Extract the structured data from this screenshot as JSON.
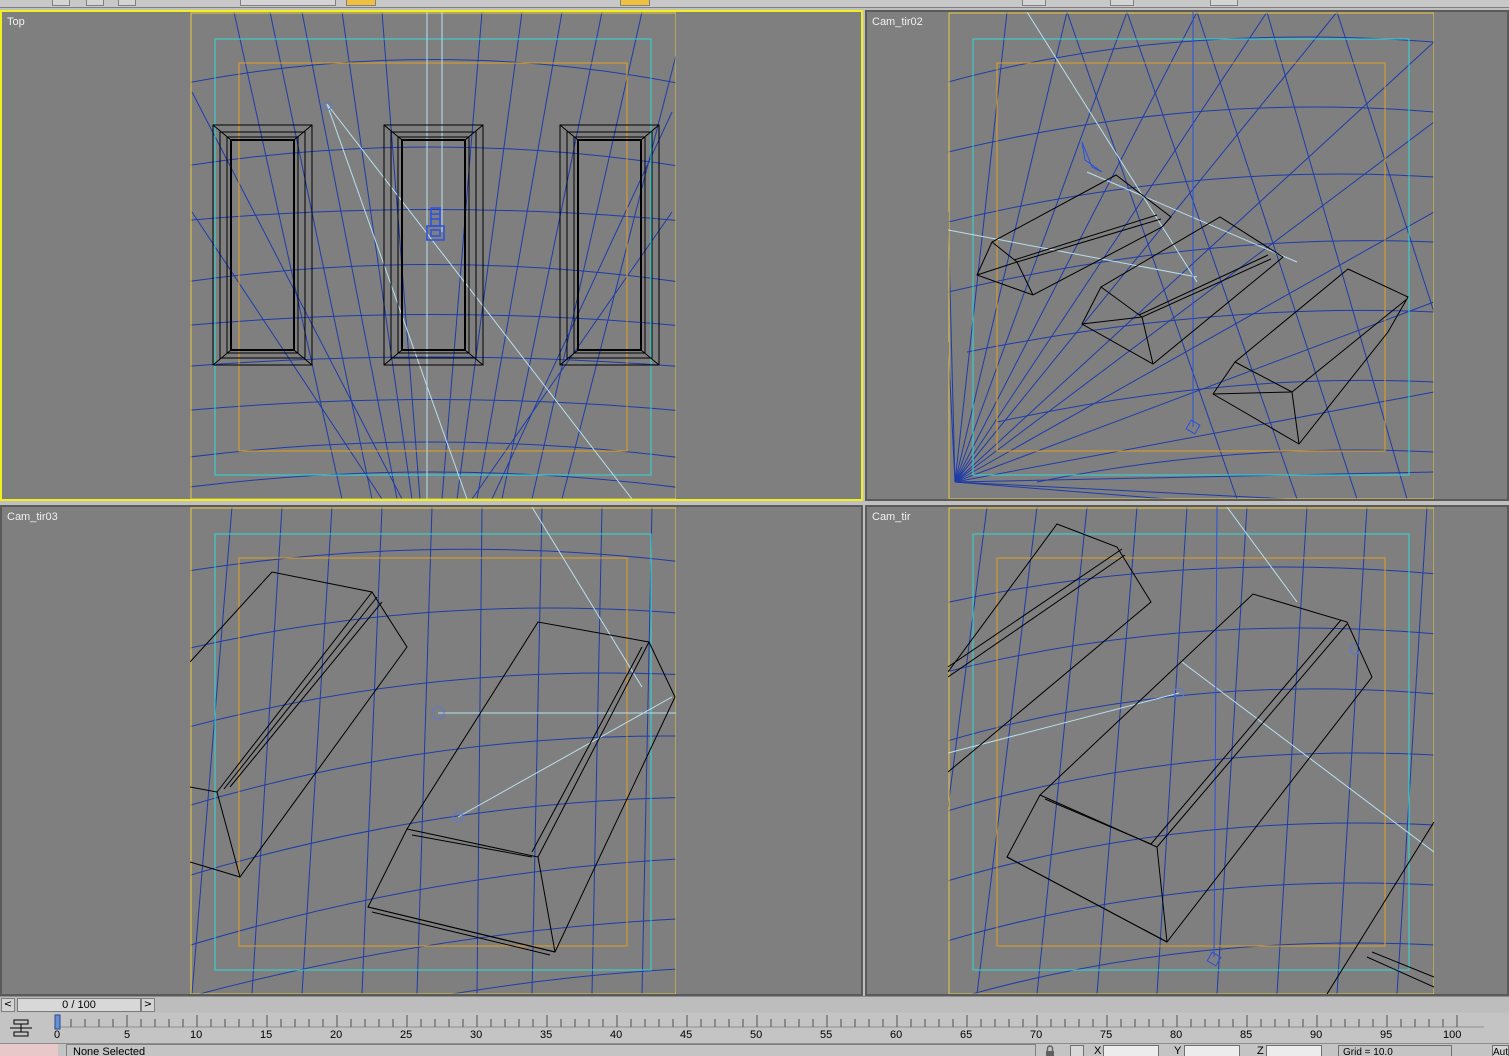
{
  "viewports": [
    {
      "id": "top",
      "label": "Top",
      "active": true
    },
    {
      "id": "cam-tir02",
      "label": "Cam_tir02",
      "active": false
    },
    {
      "id": "cam-tir03",
      "label": "Cam_tir03",
      "active": false
    },
    {
      "id": "cam-tir",
      "label": "Cam_tir",
      "active": false
    }
  ],
  "time_slider": {
    "position": "0 / 100",
    "prev_icon": "chevron-left-icon",
    "next_icon": "chevron-right-icon",
    "prev_glyph": "<",
    "next_glyph": ">"
  },
  "track_bar": {
    "ticks": [
      "0",
      "5",
      "10",
      "15",
      "20",
      "25",
      "30",
      "35",
      "40",
      "45",
      "50",
      "55",
      "60",
      "65",
      "70",
      "75",
      "80",
      "85",
      "90",
      "95",
      "100"
    ],
    "start": 0,
    "end": 100,
    "current": 0
  },
  "status_bar": {
    "selection": "None Selected",
    "x_label": "X",
    "y_label": "Y",
    "z_label": "Z",
    "x_value": "",
    "y_value": "",
    "z_value": "",
    "grid": "Grid = 10.0",
    "auto_key": "Auto"
  },
  "colors": {
    "viewport_bg": "#7f7f7f",
    "active_border": "#f0f020",
    "grid_line": "#1e3ca8",
    "safe_frame_outer": "#e8c840",
    "safe_frame_action": "#30d8d8",
    "safe_frame_title": "#e0a020",
    "light_line": "#b8e0f0",
    "wireframe": "#000000"
  }
}
